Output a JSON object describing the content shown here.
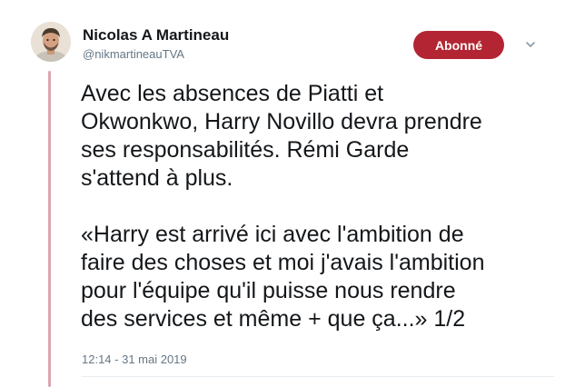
{
  "tweet": {
    "author": {
      "name": "Nicolas A Martineau",
      "handle": "@nikmartineauTVA"
    },
    "follow_label": "Abonné",
    "text": "Avec les absences de Piatti et\nOkwonkwo, Harry Novillo devra prendre\nses responsabilités. Rémi Garde\ns'attend à plus.\n\n«Harry est arrivé ici avec l'ambition de\nfaire des choses et moi j'avais l'ambition\npour l'équipe qu'il puisse nous rendre\ndes services et même + que ça...» 1/2",
    "timestamp": "12:14 - 31 mai 2019"
  },
  "colors": {
    "follow_button": "#b32532",
    "thread_line": "#d8a7ad",
    "secondary_text": "#657786"
  },
  "icons": {
    "more_menu": "chevron-down-icon"
  }
}
